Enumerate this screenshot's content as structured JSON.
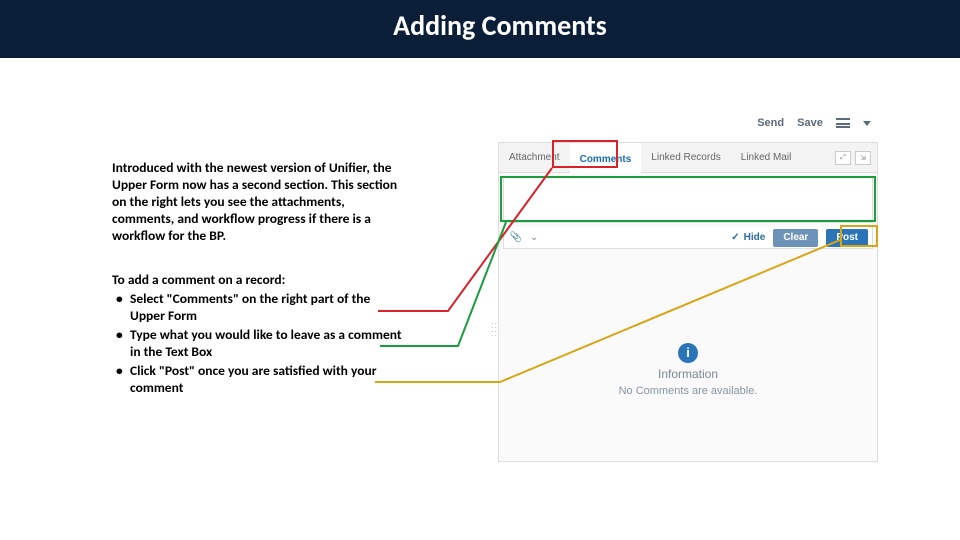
{
  "title": "Adding Comments",
  "intro": "Introduced with the newest version of Unifier, the Upper Form now has a second section. This section on the right lets you see the attachments, comments, and workflow progress if there is a workflow for the BP.",
  "steps_title": "To add a comment on a record:",
  "steps": [
    "Select \"Comments\" on the right part of the Upper Form",
    "Type what you would like to leave as a comment in the Text Box",
    "Click \"Post\" once you are satisfied with your comment"
  ],
  "topbar": {
    "send": "Send",
    "save": "Save"
  },
  "tabs": {
    "attachment": "Attachment",
    "comments": "Comments",
    "linked_records": "Linked Records",
    "linked_mail": "Linked Mail"
  },
  "footer": {
    "hide": "Hide",
    "clear": "Clear",
    "post": "Post"
  },
  "info": {
    "heading": "Information",
    "message": "No Comments are available."
  }
}
